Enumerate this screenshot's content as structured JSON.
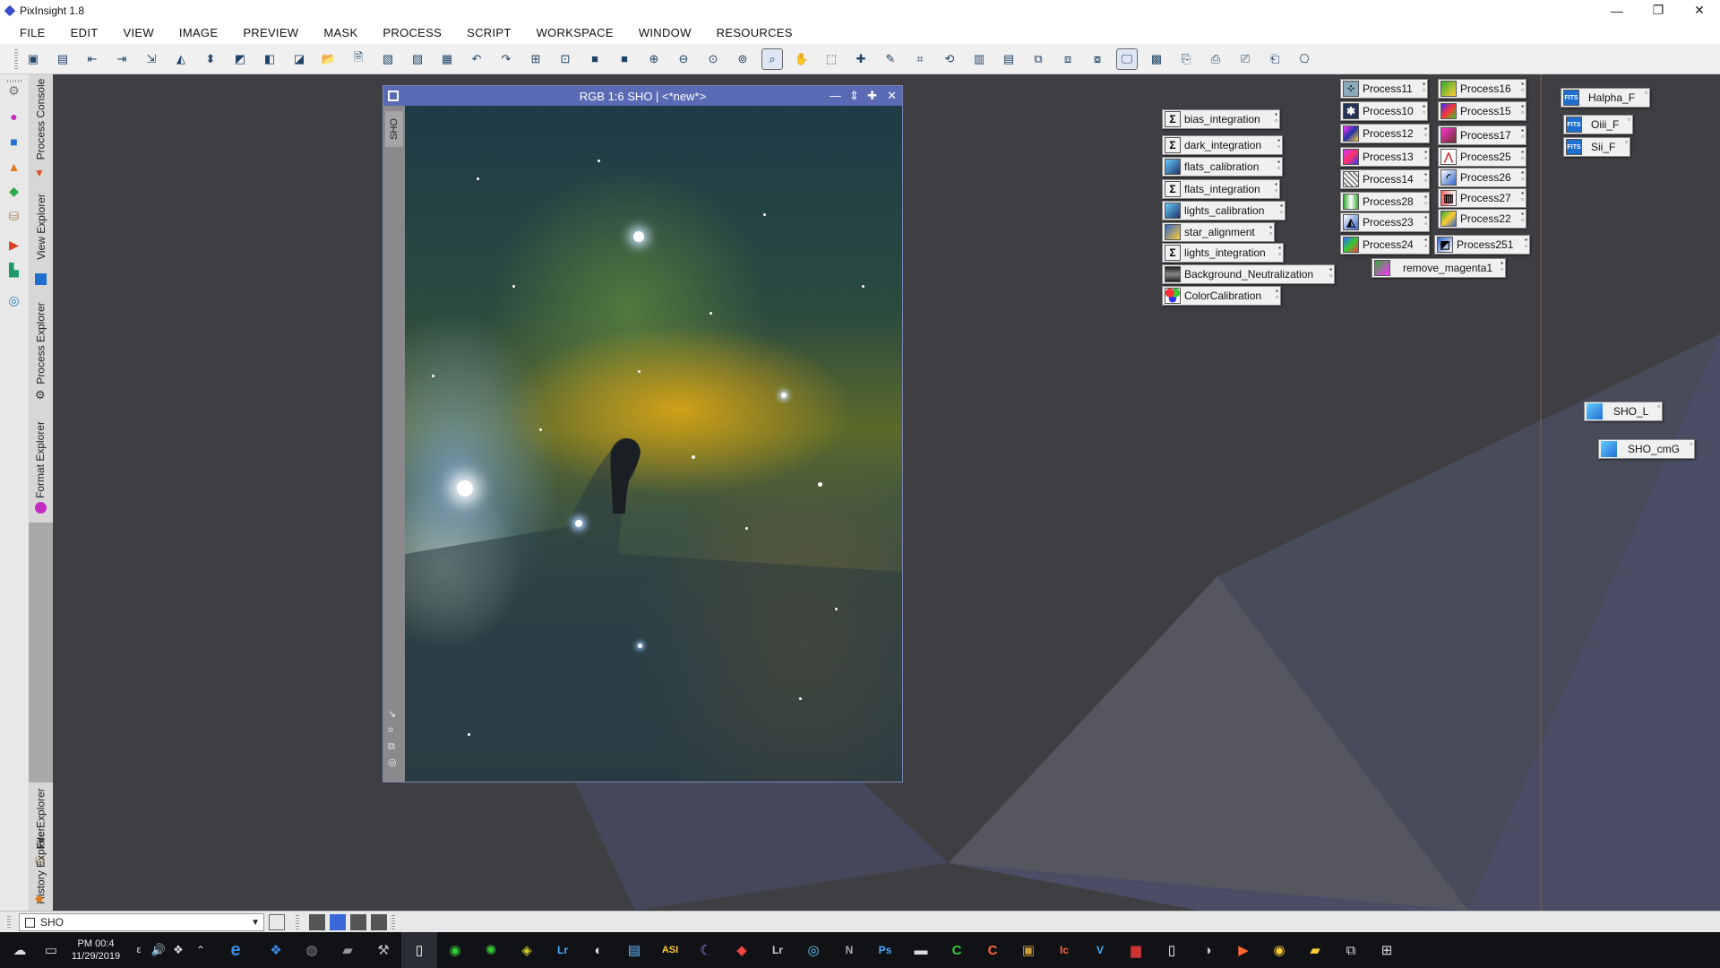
{
  "app": {
    "title": "PixInsight 1.8"
  },
  "window_controls": {
    "minimize": "—",
    "restore": "❐",
    "close": "✕"
  },
  "menu": [
    "FILE",
    "EDIT",
    "VIEW",
    "IMAGE",
    "PREVIEW",
    "MASK",
    "PROCESS",
    "SCRIPT",
    "WORKSPACE",
    "WINDOW",
    "RESOURCES"
  ],
  "side_tabs": [
    "Process Console",
    "View Explorer",
    "Process Explorer",
    "Format Explorer",
    "File Explorer",
    "History Explorer"
  ],
  "image_window": {
    "title": "RGB 1:6 SHO | <*new*>",
    "side_label": "SHO"
  },
  "process_icons_col1": [
    "bias_integration",
    "dark_integration",
    "flats_calibration",
    "flats_integration",
    "lights_calibration",
    "star_alignment",
    "lights_integration",
    "Background_Neutralization",
    "ColorCalibration"
  ],
  "process_icons_col2": [
    "Process11",
    "Process10",
    "Process12",
    "Process13",
    "Process14",
    "Process28",
    "Process23",
    "Process24"
  ],
  "process_icons_col3": [
    "Process16",
    "Process15",
    "Process17",
    "Process25",
    "Process26",
    "Process27",
    "Process22",
    "Process251"
  ],
  "process_icon_extra": "remove_magenta1",
  "fits_icons": [
    "Halpha_F",
    "Oiii_F",
    "Sii_F"
  ],
  "image_icons": [
    "SHO_L",
    "SHO_cmG"
  ],
  "bottombar": {
    "view_selector": "SHO"
  },
  "taskbar": {
    "time": "PM 00:4",
    "date": "11/29/2019",
    "lang": "ε"
  },
  "colors": {
    "image_title_bar": "#5a6ab4",
    "workspace": "#3f3f43",
    "taskbar": "#101216"
  }
}
